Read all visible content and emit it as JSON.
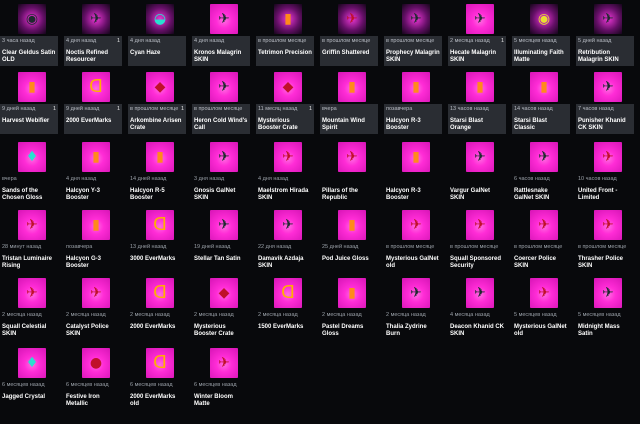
{
  "colors": {
    "background": "#08090c",
    "tile_bg": "#ff1fd2",
    "meta_bg": "#2a2d33"
  },
  "items": [
    {
      "ts": "3 часа назад",
      "name": "Clear Geldus Satin OLD",
      "count": "",
      "icon": "round-emblem-icon",
      "glyph": "◉",
      "tone": "c-ship",
      "dark": true
    },
    {
      "ts": "4 дня назад",
      "name": "Noctis Refined Resourcer",
      "count": "1",
      "icon": "ship-icon",
      "glyph": "✈",
      "tone": "c-ship",
      "dark": true
    },
    {
      "ts": "4 дня назад",
      "name": "Cyan Haze",
      "count": "",
      "icon": "helmet-icon",
      "glyph": "◒",
      "tone": "c-teal",
      "dark": true
    },
    {
      "ts": "4 дня назад",
      "name": "Kronos Malagrin SKIN",
      "count": "",
      "icon": "ship-skin-icon",
      "glyph": "✈",
      "tone": "c-ship",
      "dark": false
    },
    {
      "ts": "в прошлом месяце",
      "name": "Tetrimon Precision",
      "count": "",
      "icon": "canister-icon",
      "glyph": "▮",
      "tone": "c-orange",
      "dark": true
    },
    {
      "ts": "в прошлом месяце",
      "name": "Griffin Shattered",
      "count": "",
      "icon": "ship-icon",
      "glyph": "✈",
      "tone": "c-red",
      "dark": true
    },
    {
      "ts": "в прошлом месяце",
      "name": "Prophecy Malagrin SKIN",
      "count": "",
      "icon": "ship-skin-icon",
      "glyph": "✈",
      "tone": "c-ship",
      "dark": true
    },
    {
      "ts": "2 месяца назад",
      "name": "Hecate Malagrin SKIN",
      "count": "1",
      "icon": "ship-skin-icon",
      "glyph": "✈",
      "tone": "c-ship",
      "dark": false
    },
    {
      "ts": "5 месяцев назад",
      "name": "Illuminating Faith Matte",
      "count": "",
      "icon": "round-emblem-icon",
      "glyph": "◉",
      "tone": "c-yellow",
      "dark": true
    },
    {
      "ts": "5 дней назад",
      "name": "Retribution Malagrin SKIN",
      "count": "",
      "icon": "ship-skin-icon",
      "glyph": "✈",
      "tone": "c-ship",
      "dark": true
    },
    {
      "ts": "9 дней назад",
      "name": "Harvest Webifier",
      "count": "1",
      "icon": "module-icon",
      "glyph": "▮",
      "tone": "c-orange",
      "dark": false
    },
    {
      "ts": "9 дней назад",
      "name": "2000 EverMarks",
      "count": "1",
      "icon": "evermarks-icon",
      "glyph": "ᗡ",
      "tone": "c-gold",
      "dark": false
    },
    {
      "ts": "в прошлом месяце",
      "name": "Arkombine Arisen Crate",
      "count": "1",
      "icon": "crate-icon",
      "glyph": "◆",
      "tone": "c-red",
      "dark": false
    },
    {
      "ts": "в прошлом месяце",
      "name": "Heron Cold Wind's Call",
      "count": "",
      "icon": "ship-skin-icon",
      "glyph": "✈",
      "tone": "c-ship",
      "dark": false
    },
    {
      "ts": "11 месяц назад",
      "name": "Mysterious Booster Crate",
      "count": "1",
      "icon": "crate-icon",
      "glyph": "◆",
      "tone": "c-red",
      "dark": false
    },
    {
      "ts": "вчера",
      "name": "Mountain Wind Spirit",
      "count": "",
      "icon": "canister-icon",
      "glyph": "▮",
      "tone": "c-orange",
      "dark": false
    },
    {
      "ts": "позавчера",
      "name": "Halcyon R-3 Booster",
      "count": "",
      "icon": "booster-icon",
      "glyph": "▮",
      "tone": "c-orange",
      "dark": false
    },
    {
      "ts": "13 часов назад",
      "name": "Starsi Blast Orange",
      "count": "",
      "icon": "canister-icon",
      "glyph": "▮",
      "tone": "c-orange",
      "dark": false
    },
    {
      "ts": "14 часов назад",
      "name": "Starsi Blast Classic",
      "count": "",
      "icon": "canister-icon",
      "glyph": "▮",
      "tone": "c-orange",
      "dark": false
    },
    {
      "ts": "7 часов назад",
      "name": "Punisher Khanid CK SKIN",
      "count": "",
      "icon": "ship-skin-icon",
      "glyph": "✈",
      "tone": "c-ship",
      "dark": false
    },
    {
      "ts": "вчера",
      "name": "Sands of the Chosen Gloss",
      "count": "",
      "icon": "crystal-icon",
      "glyph": "♦",
      "tone": "c-teal",
      "dark": false
    },
    {
      "ts": "4 дня назад",
      "name": "Halcyon Y-3 Booster",
      "count": "",
      "icon": "booster-icon",
      "glyph": "▮",
      "tone": "c-orange",
      "dark": false
    },
    {
      "ts": "14 дней назад",
      "name": "Halcyon R-5 Booster",
      "count": "",
      "icon": "booster-icon",
      "glyph": "▮",
      "tone": "c-orange",
      "dark": false
    },
    {
      "ts": "3 дня назад",
      "name": "Gnosis GalNet SKIN",
      "count": "",
      "icon": "ship-skin-icon",
      "glyph": "✈",
      "tone": "c-ship",
      "dark": false
    },
    {
      "ts": "4 дня назад",
      "name": "Maelstrom Hirada SKIN",
      "count": "",
      "icon": "ship-skin-icon",
      "glyph": "✈",
      "tone": "c-red",
      "dark": false
    },
    {
      "ts": "",
      "name": "Pillars of the Republic",
      "count": "",
      "icon": "ship-skin-icon",
      "glyph": "✈",
      "tone": "c-red",
      "dark": false
    },
    {
      "ts": "",
      "name": "Halcyon R-3 Booster",
      "count": "",
      "icon": "booster-icon",
      "glyph": "▮",
      "tone": "c-orange",
      "dark": false
    },
    {
      "ts": "",
      "name": "Vargur GalNet SKIN",
      "count": "",
      "icon": "ship-skin-icon",
      "glyph": "✈",
      "tone": "c-ship",
      "dark": false
    },
    {
      "ts": "6 часов назад",
      "name": "Rattlesnake GalNet SKIN",
      "count": "",
      "icon": "ship-skin-icon",
      "glyph": "✈",
      "tone": "c-ship",
      "dark": false
    },
    {
      "ts": "10 часов назад",
      "name": "United Front - Limited",
      "count": "",
      "icon": "ship-skin-icon",
      "glyph": "✈",
      "tone": "c-red",
      "dark": false
    },
    {
      "ts": "28 минут назад",
      "name": "Tristan Luminaire Rising",
      "count": "",
      "icon": "ship-skin-icon",
      "glyph": "✈",
      "tone": "c-red",
      "dark": false
    },
    {
      "ts": "позавчера",
      "name": "Halcyon G-3 Booster",
      "count": "",
      "icon": "booster-icon",
      "glyph": "▮",
      "tone": "c-orange",
      "dark": false
    },
    {
      "ts": "13 дней назад",
      "name": "3000 EverMarks",
      "count": "",
      "icon": "evermarks-icon",
      "glyph": "ᗡ",
      "tone": "c-gold",
      "dark": false
    },
    {
      "ts": "19 дней назад",
      "name": "Stellar Tan Satin",
      "count": "",
      "icon": "ship-skin-icon",
      "glyph": "✈",
      "tone": "c-ship",
      "dark": false
    },
    {
      "ts": "22 дня назад",
      "name": "Damavik Azdaja SKIN",
      "count": "",
      "icon": "ship-skin-icon",
      "glyph": "✈",
      "tone": "c-ship",
      "dark": false
    },
    {
      "ts": "25 дней назад",
      "name": "Pod Juice Gloss",
      "count": "",
      "icon": "canister-icon",
      "glyph": "▮",
      "tone": "c-orange",
      "dark": false
    },
    {
      "ts": "в прошлом месяце",
      "name": "Mysterious GalNet old",
      "count": "",
      "icon": "ship-skin-icon",
      "glyph": "✈",
      "tone": "c-red",
      "dark": false
    },
    {
      "ts": "в прошлом месяце",
      "name": "Squall Sponsored Security",
      "count": "",
      "icon": "ship-skin-icon",
      "glyph": "✈",
      "tone": "c-red",
      "dark": false
    },
    {
      "ts": "в прошлом месяце",
      "name": "Coercer Police SKIN",
      "count": "",
      "icon": "ship-skin-icon",
      "glyph": "✈",
      "tone": "c-red",
      "dark": false
    },
    {
      "ts": "в прошлом месяце",
      "name": "Thrasher Police SKIN",
      "count": "",
      "icon": "ship-skin-icon",
      "glyph": "✈",
      "tone": "c-red",
      "dark": false
    },
    {
      "ts": "2 месяца назад",
      "name": "Squall Celestial SKIN",
      "count": "",
      "icon": "ship-skin-icon",
      "glyph": "✈",
      "tone": "c-red",
      "dark": false
    },
    {
      "ts": "2 месяца назад",
      "name": "Catalyst Police SKIN",
      "count": "",
      "icon": "ship-skin-icon",
      "glyph": "✈",
      "tone": "c-red",
      "dark": false
    },
    {
      "ts": "2 месяца назад",
      "name": "2000 EverMarks",
      "count": "",
      "icon": "evermarks-icon",
      "glyph": "ᗡ",
      "tone": "c-gold",
      "dark": false
    },
    {
      "ts": "2 месяца назад",
      "name": "Mysterious Booster Crate",
      "count": "",
      "icon": "crate-icon",
      "glyph": "◆",
      "tone": "c-red",
      "dark": false
    },
    {
      "ts": "2 месяца назад",
      "name": "1500 EverMarks",
      "count": "",
      "icon": "evermarks-icon",
      "glyph": "ᗡ",
      "tone": "c-gold",
      "dark": false
    },
    {
      "ts": "2 месяца назад",
      "name": "Pastel Dreams Gloss",
      "count": "",
      "icon": "canister-icon",
      "glyph": "▮",
      "tone": "c-orange",
      "dark": false
    },
    {
      "ts": "2 месяца назад",
      "name": "Thalia Zydrine Burn",
      "count": "",
      "icon": "ship-skin-icon",
      "glyph": "✈",
      "tone": "c-ship",
      "dark": false
    },
    {
      "ts": "4 месяца назад",
      "name": "Deacon Khanid CK SKIN",
      "count": "",
      "icon": "ship-skin-icon",
      "glyph": "✈",
      "tone": "c-ship",
      "dark": false
    },
    {
      "ts": "5 месяцев назад",
      "name": "Mysterious GalNet old",
      "count": "",
      "icon": "ship-skin-icon",
      "glyph": "✈",
      "tone": "c-red",
      "dark": false
    },
    {
      "ts": "5 месяцев назад",
      "name": "Midnight Mass Satin",
      "count": "",
      "icon": "ship-skin-icon",
      "glyph": "✈",
      "tone": "c-ship",
      "dark": false
    },
    {
      "ts": "6 месяцев назад",
      "name": "Jagged Crystal",
      "count": "",
      "icon": "crystal-icon",
      "glyph": "♦",
      "tone": "c-teal",
      "dark": false
    },
    {
      "ts": "6 месяцев назад",
      "name": "Festive Iron Metallic",
      "count": "",
      "icon": "ornament-icon",
      "glyph": "●",
      "tone": "c-red",
      "dark": false
    },
    {
      "ts": "6 месяцев назад",
      "name": "2000 EverMarks old",
      "count": "",
      "icon": "evermarks-icon",
      "glyph": "ᗡ",
      "tone": "c-gold",
      "dark": false
    },
    {
      "ts": "6 месяцев назад",
      "name": "Winter Bloom Matte",
      "count": "",
      "icon": "ship-skin-icon",
      "glyph": "✈",
      "tone": "c-red",
      "dark": false
    }
  ]
}
